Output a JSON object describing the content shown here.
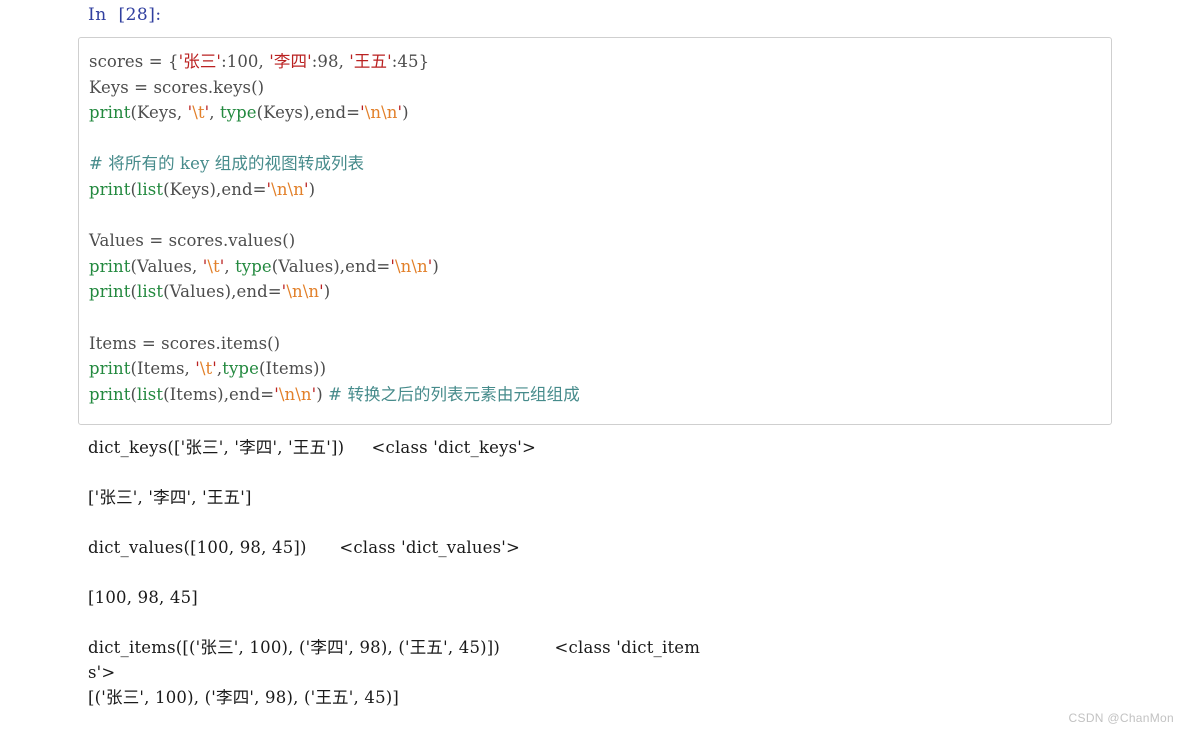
{
  "notebook": {
    "prompt": "In  [28]:",
    "execution_count": 28,
    "cell_type": "code",
    "language": "python"
  },
  "colors": {
    "prompt": "#303f9f",
    "cell_border": "#cfcfcf",
    "cell_background": "#ffffff",
    "code_text": "#4d4d4d",
    "builtin": "#23893f",
    "string": "#ba2121",
    "escape": "#e2802a",
    "comment": "#468b8b",
    "output_text": "#1a1a1a",
    "watermark": "#c2c2c2"
  },
  "code": {
    "lines": [
      {
        "id": "line-1",
        "tokens": [
          {
            "t": "scores = ",
            "c": "plain"
          },
          {
            "t": "{",
            "c": "punct"
          },
          {
            "t": "'张三'",
            "c": "string"
          },
          {
            "t": ":100, ",
            "c": "plain"
          },
          {
            "t": "'李四'",
            "c": "string"
          },
          {
            "t": ":98, ",
            "c": "plain"
          },
          {
            "t": "'王五'",
            "c": "string"
          },
          {
            "t": ":45}",
            "c": "plain"
          }
        ]
      },
      {
        "id": "line-2",
        "tokens": [
          {
            "t": "Keys = scores.keys()",
            "c": "plain"
          }
        ]
      },
      {
        "id": "line-3",
        "tokens": [
          {
            "t": "print",
            "c": "builtin"
          },
          {
            "t": "(Keys, ",
            "c": "plain"
          },
          {
            "t": "'",
            "c": "string"
          },
          {
            "t": "\\t",
            "c": "escape"
          },
          {
            "t": "'",
            "c": "string"
          },
          {
            "t": ", ",
            "c": "plain"
          },
          {
            "t": "type",
            "c": "builtin"
          },
          {
            "t": "(Keys),end=",
            "c": "plain"
          },
          {
            "t": "'",
            "c": "string"
          },
          {
            "t": "\\n\\n",
            "c": "escape"
          },
          {
            "t": "'",
            "c": "string"
          },
          {
            "t": ")",
            "c": "plain"
          }
        ]
      },
      {
        "id": "line-4",
        "tokens": []
      },
      {
        "id": "line-5",
        "tokens": [
          {
            "t": "# 将所有的 key 组成的视图转成列表",
            "c": "comment"
          }
        ]
      },
      {
        "id": "line-6",
        "tokens": [
          {
            "t": "print",
            "c": "builtin"
          },
          {
            "t": "(",
            "c": "plain"
          },
          {
            "t": "list",
            "c": "builtin"
          },
          {
            "t": "(Keys),end=",
            "c": "plain"
          },
          {
            "t": "'",
            "c": "string"
          },
          {
            "t": "\\n\\n",
            "c": "escape"
          },
          {
            "t": "'",
            "c": "string"
          },
          {
            "t": ")",
            "c": "plain"
          }
        ]
      },
      {
        "id": "line-7",
        "tokens": []
      },
      {
        "id": "line-8",
        "tokens": [
          {
            "t": "Values = scores.values()",
            "c": "plain"
          }
        ]
      },
      {
        "id": "line-9",
        "tokens": [
          {
            "t": "print",
            "c": "builtin"
          },
          {
            "t": "(Values, ",
            "c": "plain"
          },
          {
            "t": "'",
            "c": "string"
          },
          {
            "t": "\\t",
            "c": "escape"
          },
          {
            "t": "'",
            "c": "string"
          },
          {
            "t": ", ",
            "c": "plain"
          },
          {
            "t": "type",
            "c": "builtin"
          },
          {
            "t": "(Values),end=",
            "c": "plain"
          },
          {
            "t": "'",
            "c": "string"
          },
          {
            "t": "\\n\\n",
            "c": "escape"
          },
          {
            "t": "'",
            "c": "string"
          },
          {
            "t": ")",
            "c": "plain"
          }
        ]
      },
      {
        "id": "line-10",
        "tokens": [
          {
            "t": "print",
            "c": "builtin"
          },
          {
            "t": "(",
            "c": "plain"
          },
          {
            "t": "list",
            "c": "builtin"
          },
          {
            "t": "(Values),end=",
            "c": "plain"
          },
          {
            "t": "'",
            "c": "string"
          },
          {
            "t": "\\n\\n",
            "c": "escape"
          },
          {
            "t": "'",
            "c": "string"
          },
          {
            "t": ")",
            "c": "plain"
          }
        ]
      },
      {
        "id": "line-11",
        "tokens": []
      },
      {
        "id": "line-12",
        "tokens": [
          {
            "t": "Items = scores.items()",
            "c": "plain"
          }
        ]
      },
      {
        "id": "line-13",
        "tokens": [
          {
            "t": "print",
            "c": "builtin"
          },
          {
            "t": "(Items, ",
            "c": "plain"
          },
          {
            "t": "'",
            "c": "string"
          },
          {
            "t": "\\t",
            "c": "escape"
          },
          {
            "t": "'",
            "c": "string"
          },
          {
            "t": ",",
            "c": "plain"
          },
          {
            "t": "type",
            "c": "builtin"
          },
          {
            "t": "(Items))",
            "c": "plain"
          }
        ]
      },
      {
        "id": "line-14",
        "tokens": [
          {
            "t": "print",
            "c": "builtin"
          },
          {
            "t": "(",
            "c": "plain"
          },
          {
            "t": "list",
            "c": "builtin"
          },
          {
            "t": "(Items),end=",
            "c": "plain"
          },
          {
            "t": "'",
            "c": "string"
          },
          {
            "t": "\\n\\n",
            "c": "escape"
          },
          {
            "t": "'",
            "c": "string"
          },
          {
            "t": ") ",
            "c": "plain"
          },
          {
            "t": "# 转换之后的列表元素由元组组成",
            "c": "comment"
          }
        ]
      }
    ]
  },
  "output": {
    "lines": [
      {
        "id": "out-1",
        "text": "dict_keys(['张三', '李四', '王五'])     <class 'dict_keys'>"
      },
      {
        "id": "out-2",
        "text": ""
      },
      {
        "id": "out-3",
        "text": "['张三', '李四', '王五']"
      },
      {
        "id": "out-4",
        "text": ""
      },
      {
        "id": "out-5",
        "text": "dict_values([100, 98, 45])      <class 'dict_values'>"
      },
      {
        "id": "out-6",
        "text": ""
      },
      {
        "id": "out-7",
        "text": "[100, 98, 45]"
      },
      {
        "id": "out-8",
        "text": ""
      },
      {
        "id": "out-9",
        "text": "dict_items([('张三', 100), ('李四', 98), ('王五', 45)])          <class 'dict_item"
      },
      {
        "id": "out-10",
        "text": "s'>"
      },
      {
        "id": "out-11",
        "text": "[('张三', 100), ('李四', 98), ('王五', 45)]"
      }
    ]
  },
  "watermark": {
    "text": "CSDN @ChanMon"
  }
}
